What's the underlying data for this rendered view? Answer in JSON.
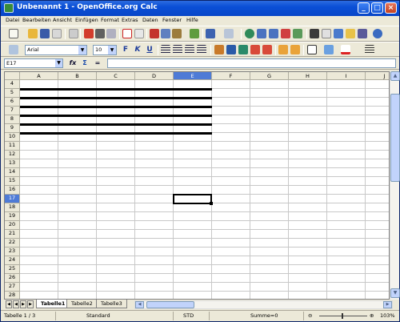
{
  "window": {
    "title": "Unbenannt 1 - OpenOffice.org Calc",
    "minimize_glyph": "_",
    "maximize_glyph": "□",
    "close_glyph": "×"
  },
  "menu": [
    "Datei",
    "Bearbeiten",
    "Ansicht",
    "Einfügen",
    "Format",
    "Extras",
    "Daten",
    "Fenster",
    "Hilfe"
  ],
  "formatting": {
    "font_name": "Arial",
    "font_size": "10",
    "bold": "F",
    "italic": "K",
    "underline": "U"
  },
  "formula_bar": {
    "name_box": "E17",
    "function_wizard": "fx",
    "sum": "Σ",
    "equals": "=",
    "formula": ""
  },
  "sheet": {
    "columns": [
      "A",
      "B",
      "C",
      "D",
      "E",
      "F",
      "G",
      "H",
      "I",
      "J"
    ],
    "active_column": "E",
    "rows": [
      "4",
      "5",
      "6",
      "7",
      "8",
      "9",
      "10",
      "11",
      "12",
      "13",
      "14",
      "15",
      "16",
      "17",
      "18",
      "19",
      "20",
      "21",
      "22",
      "23",
      "24",
      "25",
      "26",
      "27",
      "28"
    ],
    "active_row": "17",
    "selected_cell": "E17",
    "thick_border_rows": "A4:E10"
  },
  "tabs": {
    "sheets": [
      "Tabelle1",
      "Tabelle2",
      "Tabelle3"
    ],
    "active": "Tabelle1"
  },
  "status": {
    "sheet_position": "Tabelle 1 / 3",
    "page_style": "Standard",
    "selection_mode": "STD",
    "sum_label": "Summe=0",
    "zoom": "103%"
  },
  "colors": {
    "title_bar": "#0a4fd6",
    "active_header": "#4e7bd6",
    "chrome": "#ece9d8"
  }
}
